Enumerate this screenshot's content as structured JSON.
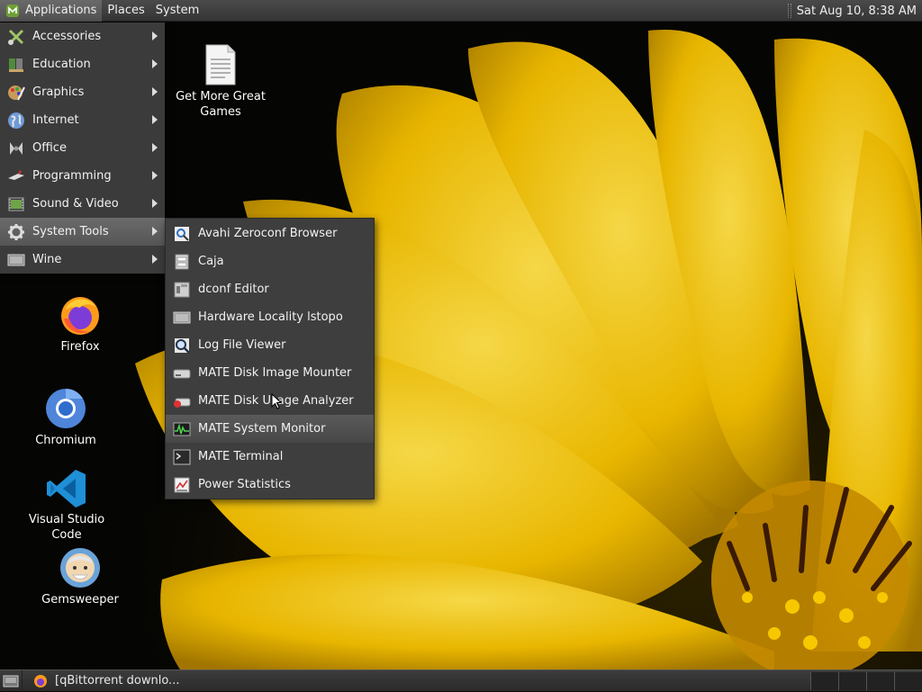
{
  "top_panel": {
    "applications": "Applications",
    "places": "Places",
    "system": "System",
    "clock": "Sat Aug 10,  8:38 AM"
  },
  "desktop": {
    "icons": [
      {
        "label": "Get More Great Games",
        "icon": "document-icon"
      },
      {
        "label": "Firefox",
        "icon": "firefox-icon"
      },
      {
        "label": "Chromium",
        "icon": "chromium-icon"
      },
      {
        "label": "Visual Studio Code",
        "icon": "vscode-icon"
      },
      {
        "label": "Gemsweeper",
        "icon": "gemsweeper-icon"
      }
    ]
  },
  "app_menu": {
    "items": [
      {
        "label": "Accessories",
        "icon": "accessories-icon"
      },
      {
        "label": "Education",
        "icon": "education-icon"
      },
      {
        "label": "Graphics",
        "icon": "graphics-icon"
      },
      {
        "label": "Internet",
        "icon": "internet-icon"
      },
      {
        "label": "Office",
        "icon": "office-icon"
      },
      {
        "label": "Programming",
        "icon": "programming-icon"
      },
      {
        "label": "Sound & Video",
        "icon": "sound-video-icon"
      },
      {
        "label": "System Tools",
        "icon": "system-tools-icon",
        "selected": true
      },
      {
        "label": "Wine",
        "icon": "wine-icon"
      }
    ]
  },
  "system_tools_menu": {
    "items": [
      {
        "label": "Avahi Zeroconf Browser",
        "icon": "avahi-icon"
      },
      {
        "label": "Caja",
        "icon": "caja-icon"
      },
      {
        "label": "dconf Editor",
        "icon": "dconf-icon"
      },
      {
        "label": "Hardware Locality lstopo",
        "icon": "lstopo-icon"
      },
      {
        "label": "Log File Viewer",
        "icon": "log-viewer-icon"
      },
      {
        "label": "MATE Disk Image Mounter",
        "icon": "disk-mounter-icon"
      },
      {
        "label": "MATE Disk Usage Analyzer",
        "icon": "disk-usage-icon"
      },
      {
        "label": "MATE System Monitor",
        "icon": "system-monitor-icon",
        "hovered": true
      },
      {
        "label": "MATE Terminal",
        "icon": "terminal-icon"
      },
      {
        "label": "Power Statistics",
        "icon": "power-statistics-icon"
      }
    ]
  },
  "taskbar": {
    "tasks": [
      {
        "label": "[qBittorrent downlo...",
        "icon": "firefox-icon"
      }
    ]
  },
  "colors": {
    "panel": "#3c3c3c",
    "menu_bg": "#3b3b3b",
    "selected": "#5a5a5a",
    "flower": "#f5c400"
  }
}
